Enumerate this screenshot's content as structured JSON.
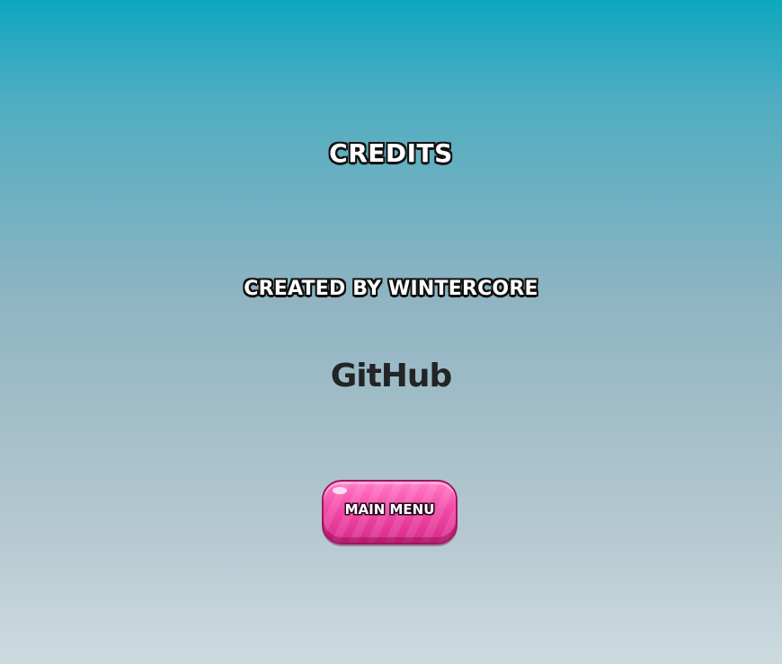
{
  "screen": {
    "title": "CREDITS",
    "credit_line": "CREATED BY WINTERCORE",
    "github_label": "GitHub",
    "main_menu_label": "MAIN MENU"
  },
  "colors": {
    "background_top": "#0ea7c0",
    "background_bottom": "#cddbe0",
    "button_pink": "#f24aa8",
    "github_text": "#222426",
    "outline": "#111111"
  }
}
